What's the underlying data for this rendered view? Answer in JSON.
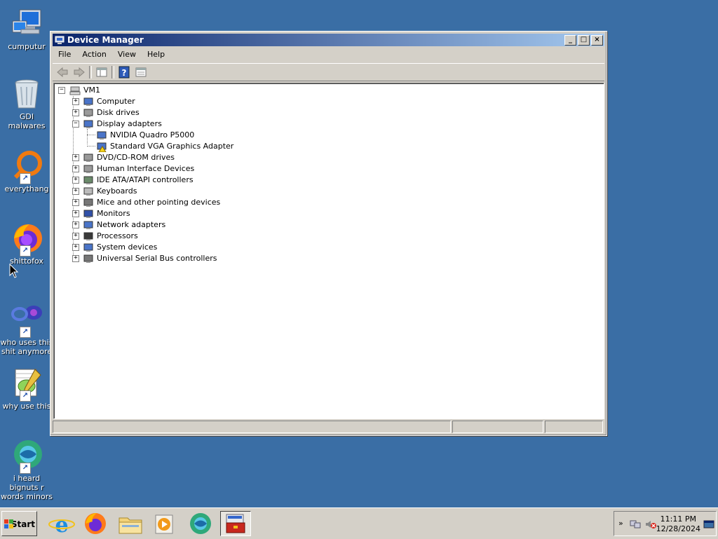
{
  "desktop": {
    "icons": [
      {
        "label": "cumputur"
      },
      {
        "label": "GDI malwares"
      },
      {
        "label": "everythang"
      },
      {
        "label": "shittofox"
      },
      {
        "label": "who uses this shit anymore"
      },
      {
        "label": "why use this"
      },
      {
        "label": "i heard bignuts r words minors"
      }
    ]
  },
  "window": {
    "title": "Device Manager",
    "controls": {
      "minimize": "_",
      "maximize": "□",
      "close": "×"
    },
    "menu": [
      "File",
      "Action",
      "View",
      "Help"
    ],
    "tree": {
      "root": "VM1",
      "items": [
        {
          "label": "Computer",
          "expander": "+"
        },
        {
          "label": "Disk drives",
          "expander": "+"
        },
        {
          "label": "Display adapters",
          "expander": "−"
        },
        {
          "label": "NVIDIA Quadro P5000",
          "expander": ""
        },
        {
          "label": "Standard VGA Graphics Adapter",
          "expander": ""
        },
        {
          "label": "DVD/CD-ROM drives",
          "expander": "+"
        },
        {
          "label": "Human Interface Devices",
          "expander": "+"
        },
        {
          "label": "IDE ATA/ATAPI controllers",
          "expander": "+"
        },
        {
          "label": "Keyboards",
          "expander": "+"
        },
        {
          "label": "Mice and other pointing devices",
          "expander": "+"
        },
        {
          "label": "Monitors",
          "expander": "+"
        },
        {
          "label": "Network adapters",
          "expander": "+"
        },
        {
          "label": "Processors",
          "expander": "+"
        },
        {
          "label": "System devices",
          "expander": "+"
        },
        {
          "label": "Universal Serial Bus controllers",
          "expander": "+"
        }
      ]
    }
  },
  "taskbar": {
    "start_label": "Start",
    "clock_time": "11:11 PM",
    "clock_date": "12/28/2024",
    "tray_arrow": "»"
  },
  "colors": {
    "desktop": "#3a6ea5",
    "titlebar_start": "#0a246a",
    "titlebar_end": "#a6caf0"
  }
}
